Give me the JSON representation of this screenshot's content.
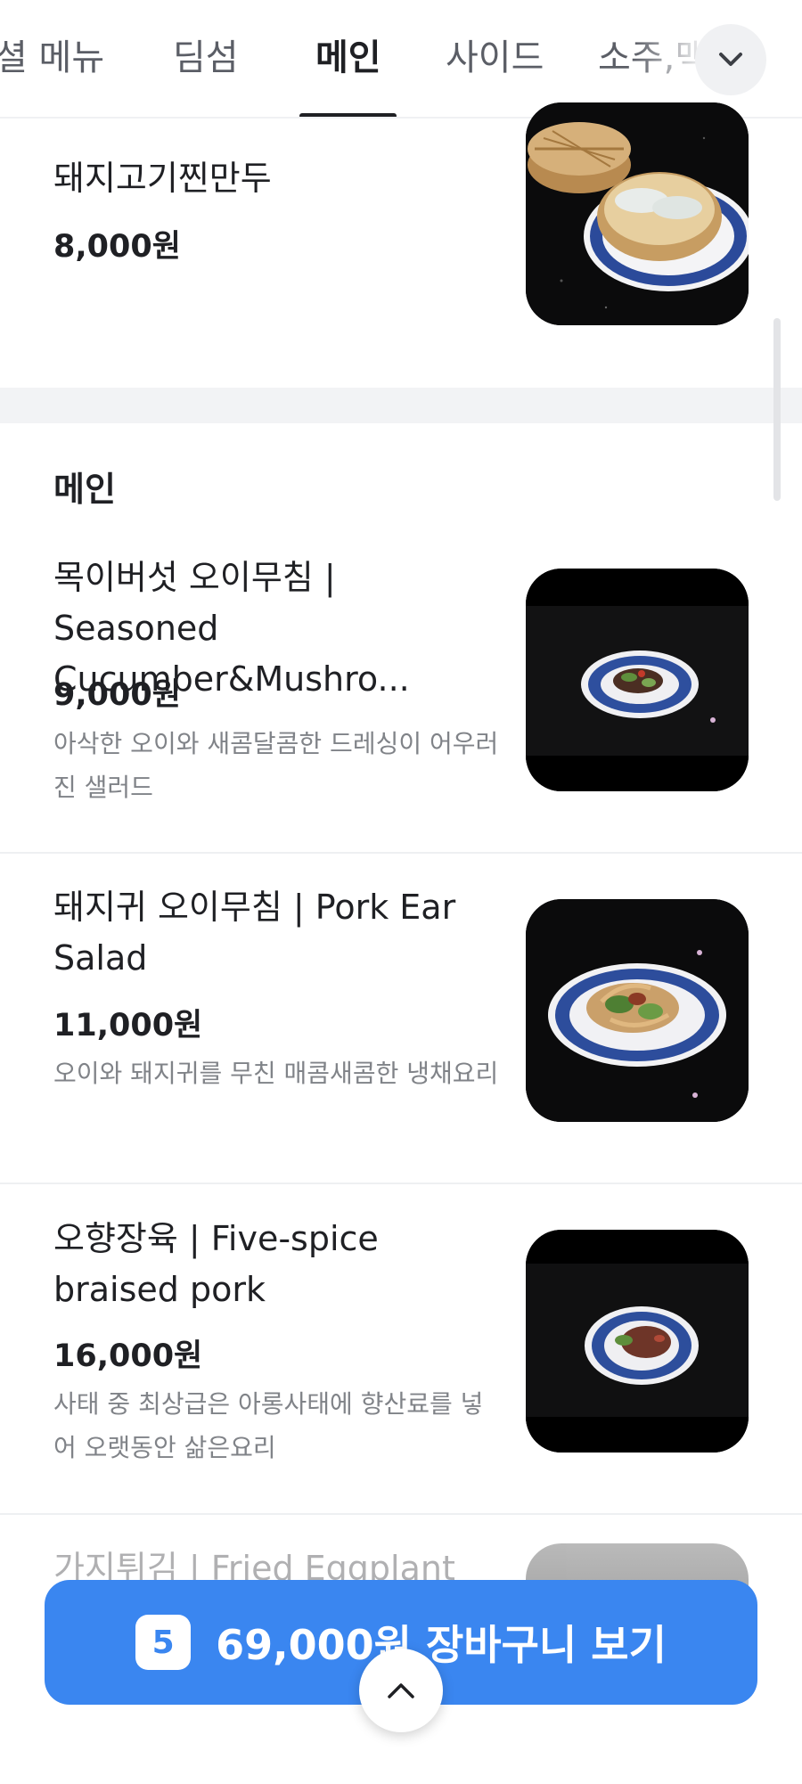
{
  "tabs": [
    {
      "label": "셜 메뉴",
      "active": false
    },
    {
      "label": "딤섬",
      "active": false
    },
    {
      "label": "메인",
      "active": true
    },
    {
      "label": "사이드",
      "active": false
    },
    {
      "label": "소주,맥",
      "active": false
    }
  ],
  "more_icon": "chevron-down-icon",
  "previous_item": {
    "name": "돼지고기찐만두",
    "price": "8,000원"
  },
  "section": {
    "title": "메인"
  },
  "items": [
    {
      "name": "목이버섯 오이무침 | Seasoned Cucumber&Mushro...",
      "price": "9,000원",
      "description": "아삭한 오이와 새콤달콤한 드레싱이 어우러진 샐러드"
    },
    {
      "name": "돼지귀 오이무침 | Pork Ear Salad",
      "price": "11,000원",
      "description": "오이와 돼지귀를 무친 매콤새콤한 냉채요리"
    },
    {
      "name": "오향장육 | Five-spice braised pork",
      "price": "16,000원",
      "description": "사태 중 최상급은 아롱사태에 향산료를 넣어 오랫동안 삶은요리"
    },
    {
      "name": "가지튀김 | Fried Eggplant",
      "price": "",
      "description": ""
    }
  ],
  "cart": {
    "count": "5",
    "label": "69,000원 장바구니 보기"
  },
  "colors": {
    "accent": "#3a86f0",
    "divider": "#eef0f2",
    "muted_text": "#808388"
  }
}
